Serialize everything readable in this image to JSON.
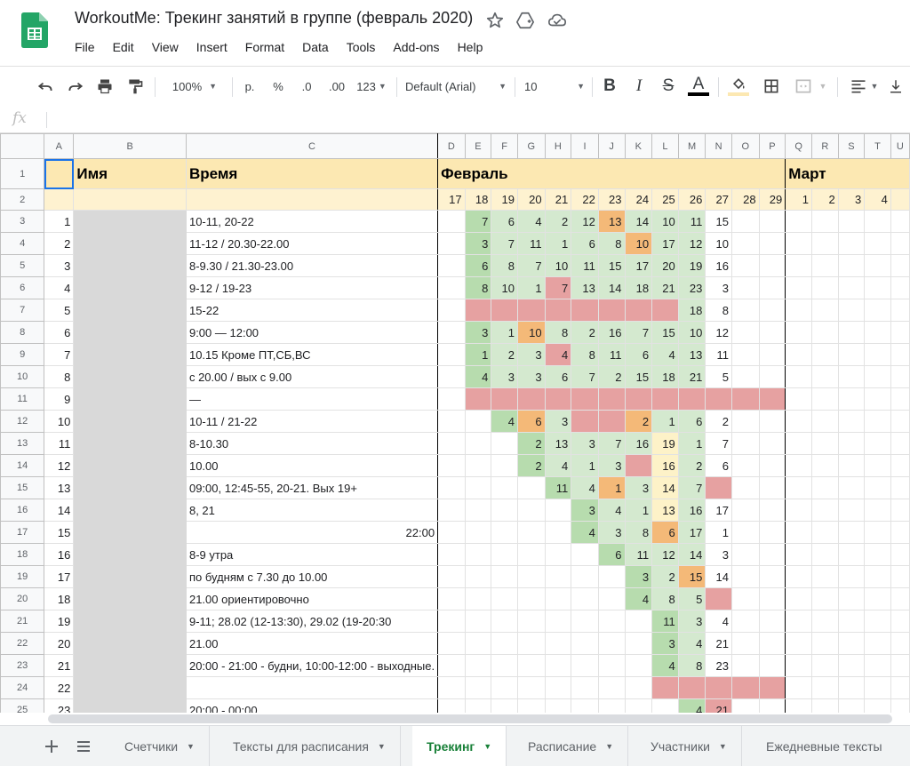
{
  "app": {
    "title": "WorkoutMe: Трекинг занятий в группе (февраль 2020)",
    "menu": [
      "File",
      "Edit",
      "View",
      "Insert",
      "Format",
      "Data",
      "Tools",
      "Add-ons",
      "Help"
    ]
  },
  "toolbar": {
    "zoom": "100%",
    "currency": "р.",
    "percent": "%",
    "dec_less": ".0",
    "dec_more": ".00",
    "more_formats": "123",
    "font": "Default (Arial)",
    "font_size": "10",
    "bold": "B",
    "italic": "I",
    "strike": "S",
    "text_color": "A"
  },
  "formula_bar": {
    "fx": "fx",
    "value": ""
  },
  "columns": [
    "A",
    "B",
    "C",
    "D",
    "E",
    "F",
    "G",
    "H",
    "I",
    "J",
    "K",
    "L",
    "M",
    "N",
    "O",
    "P",
    "Q",
    "R",
    "S",
    "T",
    "U"
  ],
  "header_row": {
    "name": "Имя",
    "time": "Время",
    "feb": "Февраль",
    "mar": "Март"
  },
  "dates_feb": [
    "17",
    "18",
    "19",
    "20",
    "21",
    "22",
    "23",
    "24",
    "25",
    "26",
    "27",
    "28",
    "29"
  ],
  "dates_mar": [
    "1",
    "2",
    "3",
    "4"
  ],
  "rows": [
    {
      "rn": "3",
      "id": "1",
      "time": "10-11, 20-22",
      "cells": [
        [
          "",
          ""
        ],
        [
          "7",
          "g2"
        ],
        [
          "6",
          "g"
        ],
        [
          "4",
          "g"
        ],
        [
          "2",
          "g"
        ],
        [
          "12",
          "g"
        ],
        [
          "13",
          "o"
        ],
        [
          "14",
          "g"
        ],
        [
          "10",
          "g"
        ],
        [
          "11",
          "g"
        ],
        [
          "15",
          ""
        ],
        [
          "",
          ""
        ],
        [
          "",
          ""
        ]
      ]
    },
    {
      "rn": "4",
      "id": "2",
      "time": "11-12 / 20.30-22.00",
      "cells": [
        [
          "",
          ""
        ],
        [
          "3",
          "g2"
        ],
        [
          "7",
          "g"
        ],
        [
          "11",
          "g"
        ],
        [
          "1",
          "g"
        ],
        [
          "6",
          "g"
        ],
        [
          "8",
          "g"
        ],
        [
          "10",
          "o"
        ],
        [
          "17",
          "g"
        ],
        [
          "12",
          "g"
        ],
        [
          "10",
          ""
        ],
        [
          "",
          ""
        ],
        [
          "",
          ""
        ]
      ]
    },
    {
      "rn": "5",
      "id": "3",
      "time": "8-9.30 / 21.30-23.00",
      "cells": [
        [
          "",
          ""
        ],
        [
          "6",
          "g2"
        ],
        [
          "8",
          "g"
        ],
        [
          "7",
          "g"
        ],
        [
          "10",
          "g"
        ],
        [
          "11",
          "g"
        ],
        [
          "15",
          "g"
        ],
        [
          "17",
          "g"
        ],
        [
          "20",
          "g"
        ],
        [
          "19",
          "g"
        ],
        [
          "16",
          ""
        ],
        [
          "",
          ""
        ],
        [
          "",
          ""
        ]
      ]
    },
    {
      "rn": "6",
      "id": "4",
      "time": "9-12 / 19-23",
      "cells": [
        [
          "",
          ""
        ],
        [
          "8",
          "g2"
        ],
        [
          "10",
          "g"
        ],
        [
          "1",
          "g"
        ],
        [
          "7",
          "r"
        ],
        [
          "13",
          "g"
        ],
        [
          "14",
          "g"
        ],
        [
          "18",
          "g"
        ],
        [
          "21",
          "g"
        ],
        [
          "23",
          "g"
        ],
        [
          "3",
          ""
        ],
        [
          "",
          ""
        ],
        [
          "",
          ""
        ]
      ]
    },
    {
      "rn": "7",
      "id": "5",
      "time": "15-22",
      "cells": [
        [
          "",
          ""
        ],
        [
          "",
          "r"
        ],
        [
          "",
          "r"
        ],
        [
          "",
          "r"
        ],
        [
          "",
          "r"
        ],
        [
          "",
          "r"
        ],
        [
          "",
          "r"
        ],
        [
          "",
          "r"
        ],
        [
          "",
          "r"
        ],
        [
          "18",
          "g"
        ],
        [
          "8",
          ""
        ],
        [
          "",
          ""
        ],
        [
          "",
          ""
        ]
      ]
    },
    {
      "rn": "8",
      "id": "6",
      "time": "9:00 — 12:00",
      "cells": [
        [
          "",
          ""
        ],
        [
          "3",
          "g2"
        ],
        [
          "1",
          "g"
        ],
        [
          "10",
          "o"
        ],
        [
          "8",
          "g"
        ],
        [
          "2",
          "g"
        ],
        [
          "16",
          "g"
        ],
        [
          "7",
          "g"
        ],
        [
          "15",
          "g"
        ],
        [
          "10",
          "g"
        ],
        [
          "12",
          ""
        ],
        [
          "",
          ""
        ],
        [
          "",
          ""
        ]
      ]
    },
    {
      "rn": "9",
      "id": "7",
      "time": "10.15 Кроме ПТ,СБ,ВС",
      "cells": [
        [
          "",
          ""
        ],
        [
          "1",
          "g2"
        ],
        [
          "2",
          "g"
        ],
        [
          "3",
          "g"
        ],
        [
          "4",
          "r"
        ],
        [
          "8",
          "g"
        ],
        [
          "11",
          "g"
        ],
        [
          "6",
          "g"
        ],
        [
          "4",
          "g"
        ],
        [
          "13",
          "g"
        ],
        [
          "11",
          ""
        ],
        [
          "",
          ""
        ],
        [
          "",
          ""
        ]
      ]
    },
    {
      "rn": "10",
      "id": "8",
      "time": "с 20.00 / вых с 9.00",
      "cells": [
        [
          "",
          ""
        ],
        [
          "4",
          "g2"
        ],
        [
          "3",
          "g"
        ],
        [
          "3",
          "g"
        ],
        [
          "6",
          "g"
        ],
        [
          "7",
          "g"
        ],
        [
          "2",
          "g"
        ],
        [
          "15",
          "g"
        ],
        [
          "18",
          "g"
        ],
        [
          "21",
          "g"
        ],
        [
          "5",
          ""
        ],
        [
          "",
          ""
        ],
        [
          "",
          ""
        ]
      ]
    },
    {
      "rn": "11",
      "id": "9",
      "time": "—",
      "cells": [
        [
          "",
          ""
        ],
        [
          "",
          "r"
        ],
        [
          "",
          "r"
        ],
        [
          "",
          "r"
        ],
        [
          "",
          "r"
        ],
        [
          "",
          "r"
        ],
        [
          "",
          "r"
        ],
        [
          "",
          "r"
        ],
        [
          "",
          "r"
        ],
        [
          "",
          "r"
        ],
        [
          "",
          "r"
        ],
        [
          "",
          "r"
        ],
        [
          "",
          "r"
        ]
      ]
    },
    {
      "rn": "12",
      "id": "10",
      "time": "10-11 / 21-22",
      "cells": [
        [
          "",
          ""
        ],
        [
          "",
          ""
        ],
        [
          "4",
          "g2"
        ],
        [
          "6",
          "o"
        ],
        [
          "3",
          "g"
        ],
        [
          "",
          "r"
        ],
        [
          "",
          "r"
        ],
        [
          "2",
          "o"
        ],
        [
          "1",
          "g"
        ],
        [
          "6",
          "g"
        ],
        [
          "2",
          ""
        ],
        [
          "",
          ""
        ],
        [
          "",
          ""
        ]
      ]
    },
    {
      "rn": "13",
      "id": "11",
      "time": "8-10.30",
      "cells": [
        [
          "",
          ""
        ],
        [
          "",
          ""
        ],
        [
          "",
          ""
        ],
        [
          "2",
          "g2"
        ],
        [
          "13",
          "g"
        ],
        [
          "3",
          "g"
        ],
        [
          "7",
          "g"
        ],
        [
          "16",
          "g"
        ],
        [
          "19",
          "y"
        ],
        [
          "1",
          "g"
        ],
        [
          "7",
          ""
        ],
        [
          "",
          ""
        ],
        [
          "",
          ""
        ]
      ]
    },
    {
      "rn": "14",
      "id": "12",
      "time": "10.00",
      "cells": [
        [
          "",
          ""
        ],
        [
          "",
          ""
        ],
        [
          "",
          ""
        ],
        [
          "2",
          "g2"
        ],
        [
          "4",
          "g"
        ],
        [
          "1",
          "g"
        ],
        [
          "3",
          "g"
        ],
        [
          "",
          "r"
        ],
        [
          "16",
          "y"
        ],
        [
          "2",
          "g"
        ],
        [
          "6",
          ""
        ],
        [
          "",
          ""
        ],
        [
          "",
          ""
        ]
      ]
    },
    {
      "rn": "15",
      "id": "13",
      "time": "09:00, 12:45-55, 20-21. Вых 19+",
      "cells": [
        [
          "",
          ""
        ],
        [
          "",
          ""
        ],
        [
          "",
          ""
        ],
        [
          "",
          ""
        ],
        [
          "11",
          "g2"
        ],
        [
          "4",
          "g"
        ],
        [
          "1",
          "o"
        ],
        [
          "3",
          "g"
        ],
        [
          "14",
          "y"
        ],
        [
          "7",
          "g"
        ],
        [
          "",
          "r"
        ],
        [
          "",
          ""
        ],
        [
          "",
          ""
        ]
      ]
    },
    {
      "rn": "16",
      "id": "14",
      "time": "8, 21",
      "cells": [
        [
          "",
          ""
        ],
        [
          "",
          ""
        ],
        [
          "",
          ""
        ],
        [
          "",
          ""
        ],
        [
          "",
          ""
        ],
        [
          "3",
          "g2"
        ],
        [
          "4",
          "g"
        ],
        [
          "1",
          "g"
        ],
        [
          "13",
          "y"
        ],
        [
          "16",
          "g"
        ],
        [
          "17",
          ""
        ],
        [
          "",
          ""
        ],
        [
          "",
          ""
        ]
      ]
    },
    {
      "rn": "17",
      "id": "15",
      "time": "22:00",
      "time_right": true,
      "cells": [
        [
          "",
          ""
        ],
        [
          "",
          ""
        ],
        [
          "",
          ""
        ],
        [
          "",
          ""
        ],
        [
          "",
          ""
        ],
        [
          "4",
          "g2"
        ],
        [
          "3",
          "g"
        ],
        [
          "8",
          "g"
        ],
        [
          "6",
          "o"
        ],
        [
          "17",
          "g"
        ],
        [
          "1",
          ""
        ],
        [
          "",
          ""
        ],
        [
          "",
          ""
        ]
      ]
    },
    {
      "rn": "18",
      "id": "16",
      "time": "8-9 утра",
      "cells": [
        [
          "",
          ""
        ],
        [
          "",
          ""
        ],
        [
          "",
          ""
        ],
        [
          "",
          ""
        ],
        [
          "",
          ""
        ],
        [
          "",
          ""
        ],
        [
          "6",
          "g2"
        ],
        [
          "11",
          "g"
        ],
        [
          "12",
          "g"
        ],
        [
          "14",
          "g"
        ],
        [
          "3",
          ""
        ],
        [
          "",
          ""
        ],
        [
          "",
          ""
        ]
      ]
    },
    {
      "rn": "19",
      "id": "17",
      "time": "по будням с 7.30 до 10.00",
      "cells": [
        [
          "",
          ""
        ],
        [
          "",
          ""
        ],
        [
          "",
          ""
        ],
        [
          "",
          ""
        ],
        [
          "",
          ""
        ],
        [
          "",
          ""
        ],
        [
          "",
          ""
        ],
        [
          "3",
          "g2"
        ],
        [
          "2",
          "g"
        ],
        [
          "15",
          "o"
        ],
        [
          "14",
          ""
        ],
        [
          "",
          ""
        ],
        [
          "",
          ""
        ]
      ]
    },
    {
      "rn": "20",
      "id": "18",
      "time": "21.00 ориентировочно",
      "cells": [
        [
          "",
          ""
        ],
        [
          "",
          ""
        ],
        [
          "",
          ""
        ],
        [
          "",
          ""
        ],
        [
          "",
          ""
        ],
        [
          "",
          ""
        ],
        [
          "",
          ""
        ],
        [
          "4",
          "g2"
        ],
        [
          "8",
          "g"
        ],
        [
          "5",
          "g"
        ],
        [
          "",
          "r"
        ],
        [
          "",
          ""
        ],
        [
          "",
          ""
        ]
      ]
    },
    {
      "rn": "21",
      "id": "19",
      "time": "9-11; 28.02 (12-13:30), 29.02 (19-20:30",
      "cells": [
        [
          "",
          ""
        ],
        [
          "",
          ""
        ],
        [
          "",
          ""
        ],
        [
          "",
          ""
        ],
        [
          "",
          ""
        ],
        [
          "",
          ""
        ],
        [
          "",
          ""
        ],
        [
          "",
          ""
        ],
        [
          "11",
          "g2"
        ],
        [
          "3",
          "g"
        ],
        [
          "4",
          ""
        ],
        [
          "",
          ""
        ],
        [
          "",
          ""
        ]
      ]
    },
    {
      "rn": "22",
      "id": "20",
      "time": "21.00",
      "cells": [
        [
          "",
          ""
        ],
        [
          "",
          ""
        ],
        [
          "",
          ""
        ],
        [
          "",
          ""
        ],
        [
          "",
          ""
        ],
        [
          "",
          ""
        ],
        [
          "",
          ""
        ],
        [
          "",
          ""
        ],
        [
          "3",
          "g2"
        ],
        [
          "4",
          "g"
        ],
        [
          "21",
          ""
        ],
        [
          "",
          ""
        ],
        [
          "",
          ""
        ]
      ]
    },
    {
      "rn": "23",
      "id": "21",
      "time": "20:00 - 21:00 - будни, 10:00-12:00 - выходные.",
      "cells": [
        [
          "",
          ""
        ],
        [
          "",
          ""
        ],
        [
          "",
          ""
        ],
        [
          "",
          ""
        ],
        [
          "",
          ""
        ],
        [
          "",
          ""
        ],
        [
          "",
          ""
        ],
        [
          "",
          ""
        ],
        [
          "4",
          "g2"
        ],
        [
          "8",
          "g"
        ],
        [
          "23",
          ""
        ],
        [
          "",
          ""
        ],
        [
          "",
          ""
        ]
      ]
    },
    {
      "rn": "24",
      "id": "22",
      "time": "",
      "cells": [
        [
          "",
          ""
        ],
        [
          "",
          ""
        ],
        [
          "",
          ""
        ],
        [
          "",
          ""
        ],
        [
          "",
          ""
        ],
        [
          "",
          ""
        ],
        [
          "",
          ""
        ],
        [
          "",
          ""
        ],
        [
          "",
          "r"
        ],
        [
          "",
          "r"
        ],
        [
          "",
          "r"
        ],
        [
          "",
          "r"
        ],
        [
          "",
          "r"
        ]
      ]
    },
    {
      "rn": "25",
      "id": "23",
      "time": "20:00 - 00:00",
      "cells": [
        [
          "",
          ""
        ],
        [
          "",
          ""
        ],
        [
          "",
          ""
        ],
        [
          "",
          ""
        ],
        [
          "",
          ""
        ],
        [
          "",
          ""
        ],
        [
          "",
          ""
        ],
        [
          "",
          ""
        ],
        [
          "",
          ""
        ],
        [
          "4",
          "g2"
        ],
        [
          "21",
          "r"
        ],
        [
          "",
          ""
        ],
        [
          "",
          ""
        ]
      ]
    }
  ],
  "tabs": [
    "Счетчики",
    "Тексты для расписания",
    "Трекинг",
    "Расписание",
    "Участники",
    "Ежедневные тексты"
  ],
  "active_tab": "Трекинг"
}
